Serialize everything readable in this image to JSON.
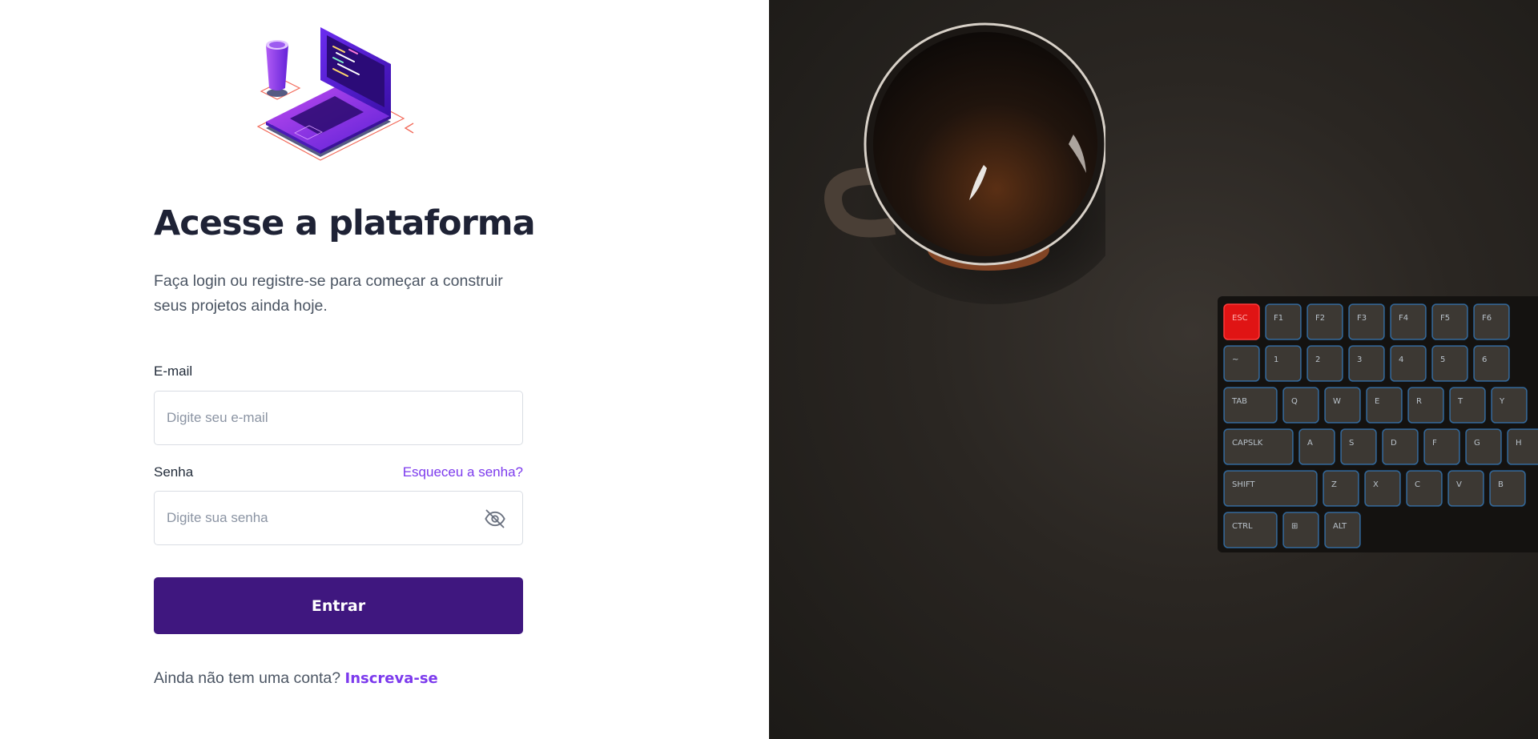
{
  "login": {
    "title": "Acesse a plataforma",
    "subtitle": "Faça login ou registre-se para começar a construir seus projetos ainda hoje.",
    "email": {
      "label": "E-mail",
      "placeholder": "Digite seu e-mail",
      "value": ""
    },
    "password": {
      "label": "Senha",
      "placeholder": "Digite sua senha",
      "value": "",
      "visibility_icon": "eye-off-icon"
    },
    "forgot_label": "Esqueceu a senha?",
    "submit_label": "Entrar",
    "signup_prompt": "Ainda não tem uma conta?",
    "signup_link": "Inscreva-se"
  },
  "hero": {
    "illustration": "laptop-coffee-illustration",
    "photo": "coffee-mug-and-keyboard-photo"
  },
  "keyboard": {
    "row1": [
      "ESC",
      "F1",
      "F2",
      "F3",
      "F4",
      "F5",
      "F6"
    ],
    "row2": [
      "~",
      "1",
      "2",
      "3",
      "4",
      "5",
      "6"
    ],
    "row3": [
      "TAB",
      "Q",
      "W",
      "E",
      "R",
      "T",
      "Y"
    ],
    "row4": [
      "CAPSLK",
      "A",
      "S",
      "D",
      "F",
      "G",
      "H"
    ],
    "row5": [
      "SHIFT",
      "Z",
      "X",
      "C",
      "V",
      "B"
    ],
    "row6": [
      "CTRL",
      "⊞",
      "ALT"
    ]
  },
  "colors": {
    "primary": "#3f177f",
    "accent": "#7c3aed",
    "title": "#1e2235",
    "text": "#4b5563"
  }
}
